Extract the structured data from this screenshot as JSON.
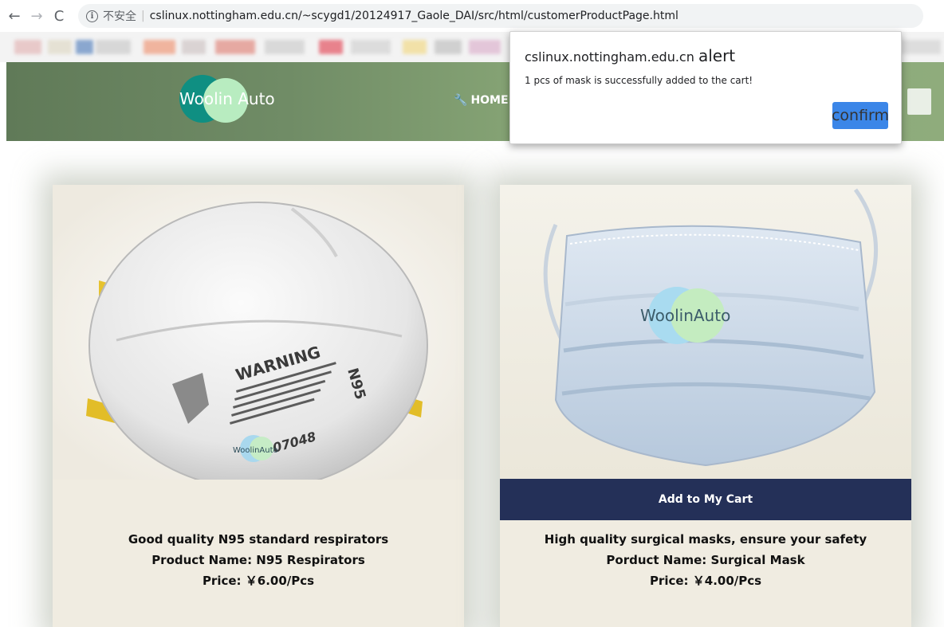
{
  "browser": {
    "insecure_label": "不安全",
    "separator": "|",
    "url": "cslinux.nottingham.edu.cn/~scygd1/20124917_Gaole_DAI/src/html/customerProductPage.html"
  },
  "header": {
    "logo_text": "Woolin Auto",
    "nav_home": "HOME"
  },
  "products": [
    {
      "description": "Good quality N95 standard respirators",
      "name": "Product Name: N95 Respirators",
      "price": "Price: ￥6.00/Pcs",
      "image_label": "WARNING",
      "image_mark": "N95",
      "image_code": "07048",
      "watermark": "WoolinAuto"
    },
    {
      "description": "High quality surgical masks, ensure your safety",
      "name": "Porduct Name: Surgical Mask",
      "price": "Price: ￥4.00/Pcs",
      "add_to_cart": "Add to My Cart",
      "watermark": "WoolinAuto"
    }
  ],
  "alert": {
    "origin": "cslinux.nottingham.edu.cn",
    "keyword": "alert",
    "message": "1 pcs of mask is successfully added to the cart!",
    "confirm_label": "confirm"
  }
}
